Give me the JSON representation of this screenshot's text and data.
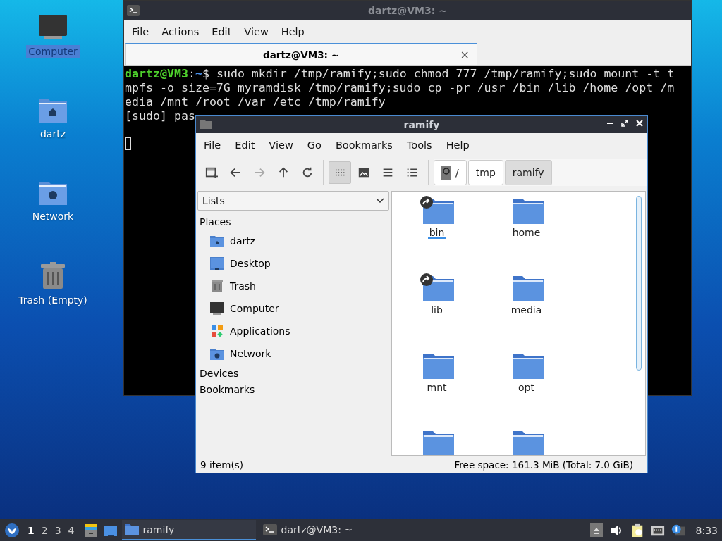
{
  "desktop_icons": [
    {
      "label": "Computer",
      "kind": "computer",
      "selected": true
    },
    {
      "label": "dartz",
      "kind": "home",
      "selected": false
    },
    {
      "label": "Network",
      "kind": "network",
      "selected": false
    },
    {
      "label": "Trash (Empty)",
      "kind": "trash",
      "selected": false
    }
  ],
  "terminal": {
    "title": "dartz@VM3: ~",
    "menu": [
      "File",
      "Actions",
      "Edit",
      "View",
      "Help"
    ],
    "tab": {
      "label": "dartz@VM3: ~",
      "close": "×"
    },
    "prompt": {
      "user": "dartz@VM3",
      "sep": ":",
      "path": "~",
      "symbol": "$"
    },
    "lines": [
      " sudo mkdir /tmp/ramify;sudo chmod 777 /tmp/ramify;sudo mount -t t",
      "mpfs -o size=7G myramdisk /tmp/ramify;sudo cp -pr /usr /bin /lib /home /opt /m",
      "edia /mnt /root /var /etc /tmp/ramify",
      "[sudo] pas"
    ]
  },
  "file_manager": {
    "title": "ramify",
    "menu": [
      "File",
      "Edit",
      "View",
      "Go",
      "Bookmarks",
      "Tools",
      "Help"
    ],
    "nav": [
      {
        "kind": "new-window",
        "disabled": false
      },
      {
        "kind": "back",
        "disabled": false
      },
      {
        "kind": "forward",
        "disabled": true
      },
      {
        "kind": "up",
        "disabled": false
      },
      {
        "kind": "reload",
        "disabled": false
      }
    ],
    "views": [
      {
        "kind": "icons",
        "selected": true
      },
      {
        "kind": "thumbnails",
        "selected": false
      },
      {
        "kind": "compact",
        "selected": false
      },
      {
        "kind": "details",
        "selected": false
      }
    ],
    "path": [
      {
        "label": "/",
        "kind": "root",
        "selected": false
      },
      {
        "label": "tmp",
        "kind": "dir",
        "selected": false
      },
      {
        "label": "ramify",
        "kind": "dir",
        "selected": true
      }
    ],
    "side_pane_mode": "Lists",
    "sections": [
      {
        "label": "Places",
        "items": [
          {
            "label": "dartz",
            "kind": "home"
          },
          {
            "label": "Desktop",
            "kind": "desktop"
          },
          {
            "label": "Trash",
            "kind": "trash"
          },
          {
            "label": "Computer",
            "kind": "computer"
          },
          {
            "label": "Applications",
            "kind": "apps"
          },
          {
            "label": "Network",
            "kind": "network"
          }
        ]
      },
      {
        "label": "Devices"
      },
      {
        "label": "Bookmarks"
      }
    ],
    "files": [
      {
        "name": "bin",
        "link": true,
        "focused": true
      },
      {
        "name": "home",
        "link": false,
        "focused": false
      },
      {
        "name": "lib",
        "link": true,
        "focused": false
      },
      {
        "name": "media",
        "link": false,
        "focused": false
      },
      {
        "name": "mnt",
        "link": false,
        "focused": false
      },
      {
        "name": "opt",
        "link": false,
        "focused": false
      },
      {
        "link": false
      },
      {
        "link": false
      }
    ],
    "status_left": "9 item(s)",
    "status_right": "Free space: 161.3 MiB (Total: 7.0 GiB)"
  },
  "taskbar": {
    "workspaces": [
      {
        "label": "1",
        "selected": true
      },
      {
        "label": "2",
        "selected": false
      },
      {
        "label": "3",
        "selected": false
      },
      {
        "label": "4",
        "selected": false
      }
    ],
    "tasks": [
      {
        "label": "ramify",
        "kind": "folder",
        "selected": true
      },
      {
        "label": "dartz@VM3: ~",
        "kind": "terminal",
        "selected": false
      }
    ],
    "clock": "8:33"
  }
}
